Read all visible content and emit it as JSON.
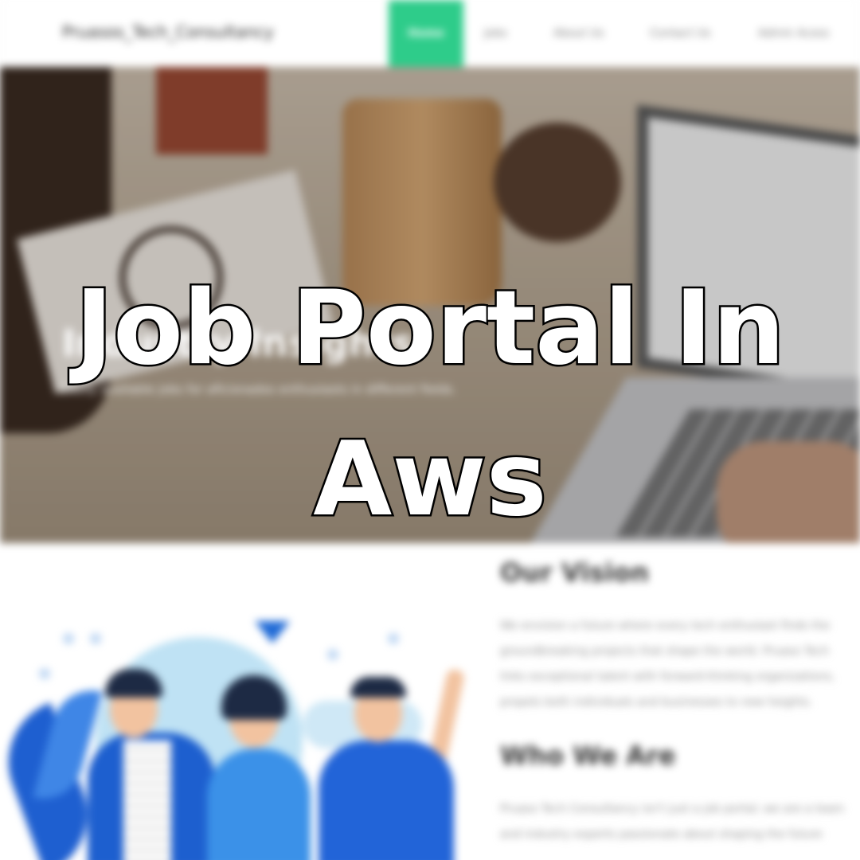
{
  "overlay": {
    "line1": "Job Portal In",
    "line2": "Aws"
  },
  "navbar": {
    "brand": "Pruasos_Tech_Consultancy",
    "items": [
      {
        "label": "Home",
        "active": true
      },
      {
        "label": "Jobs"
      },
      {
        "label": "About Us"
      },
      {
        "label": "Contact Us"
      },
      {
        "label": "Admin Acess"
      }
    ],
    "accent_color": "#2ecc8a"
  },
  "hero": {
    "heading": "Industry Insights",
    "subtext": "Easily available jobs for aficionados enthusiasts in different fields."
  },
  "vision": {
    "title": "Our Vision",
    "lines": [
      "We envision a future where every tech enthusiast finds the",
      "groundbreaking projects that shape the world. Pruaso Tech",
      "links exceptional talent with forward-thinking organizations,",
      "propels both individuals and businesses to new heights."
    ]
  },
  "who_we_are": {
    "title": "Who We Are",
    "lines": [
      "Pruaso Tech Consultancy isn't just a job portal; we are a team",
      "and industry experts passionate about shaping the future"
    ]
  },
  "illustration": {
    "icon": "team-people-illustration"
  }
}
